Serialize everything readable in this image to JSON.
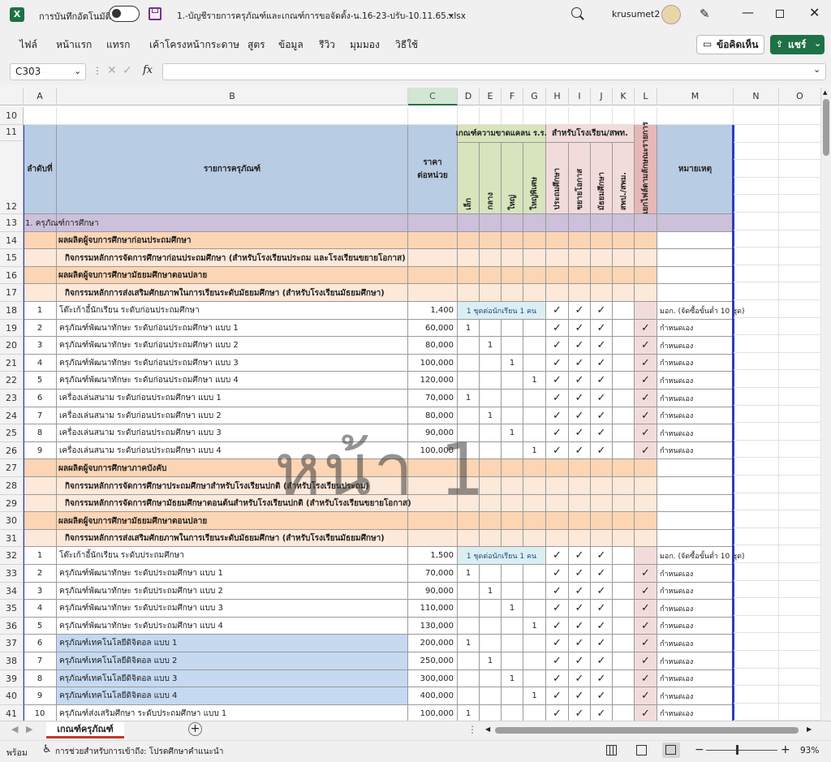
{
  "titlebar": {
    "autosave_label": "การบันทึกอัตโนมัติ",
    "filename": "1.-บัญชีรายการครุภัณฑ์และเกณฑ์การขอจัดตั้ง-น.16-23-ปรับ-10.11.65.xlsx",
    "user": "krusumet2"
  },
  "ribbon": {
    "tabs": [
      "ไฟล์",
      "หน้าแรก",
      "แทรก",
      "เค้าโครงหน้ากระดาษ",
      "สูตร",
      "ข้อมูล",
      "รีวิว",
      "มุมมอง",
      "วิธีใช้"
    ],
    "comments_label": "ข้อคิดเห็น",
    "share_label": "แชร์"
  },
  "formula_bar": {
    "name_box": "C303",
    "fx": "fx",
    "content": ""
  },
  "columns": [
    "A",
    "B",
    "C",
    "D",
    "E",
    "F",
    "G",
    "H",
    "I",
    "J",
    "K",
    "L",
    "M",
    "N",
    "O"
  ],
  "selected_column": "C",
  "header": {
    "col_a": "ลำดับที่",
    "col_b": "รายการครุภัณฑ์",
    "col_c_line1": "ราคา",
    "col_c_line2": "ต่อหน่วย",
    "group_size": "เกณฑ์ความขาดแคลน ร.ร.",
    "group_school": "สำหรับโรงเรียน/สพท.",
    "size_small": "เล็ก",
    "size_medium": "กลาง",
    "size_large": "ใหญ่",
    "size_xlarge": "ใหญ่พิเศษ",
    "school_primary": "ประถมศึกษา",
    "school_extended": "ขยายโอกาส",
    "school_secondary": "มัธยมศึกษา",
    "school_office": "สพป./สพม.",
    "col_l": "แยกไฟล์ตามลักษณะรายการ",
    "col_m": "หมายเหตุ"
  },
  "rows": [
    {
      "r": "13",
      "type": "cat",
      "b": "1. ครุภัณฑ์การศึกษา"
    },
    {
      "r": "14",
      "type": "sec",
      "b": "ผลผลิตผู้จบการศึกษาก่อนประถมศึกษา"
    },
    {
      "r": "15",
      "type": "sub",
      "b": "กิจกรรมหลักการจัดการศึกษาก่อนประถมศึกษา  (สำหรับโรงเรียนประถม และโรงเรียนขยายโอกาส)"
    },
    {
      "r": "16",
      "type": "sec",
      "b": "ผลผลิตผู้จบการศึกษามัธยมศึกษาตอนปลาย"
    },
    {
      "r": "17",
      "type": "sub",
      "b": "กิจกรรมหลักการส่งเสริมศักยภาพในการเรียนระดับมัธยมศึกษา (สำหรับโรงเรียนมัธยมศึกษา)"
    },
    {
      "r": "18",
      "type": "item",
      "a": "1",
      "b": "โต๊ะเก้าอี้นักเรียน ระดับก่อนประถมศึกษา",
      "c": "1,400",
      "d": "1  ชุดต่อนักเรียน  1  คน",
      "h": "✓",
      "i": "✓",
      "j": "✓",
      "l": "",
      "m": "มอก. (จัดซื้อขั้นต่ำ 10 ชุด)"
    },
    {
      "r": "19",
      "type": "item",
      "a": "2",
      "b": "ครุภัณฑ์พัฒนาทักษะ ระดับก่อนประถมศึกษา  แบบ  1",
      "c": "60,000",
      "d": "1",
      "h": "✓",
      "i": "✓",
      "j": "✓",
      "l": "✓",
      "m": "กำหนดเอง"
    },
    {
      "r": "20",
      "type": "item",
      "a": "3",
      "b": "ครุภัณฑ์พัฒนาทักษะ ระดับก่อนประถมศึกษา  แบบ  2",
      "c": "80,000",
      "e": "1",
      "h": "✓",
      "i": "✓",
      "j": "✓",
      "l": "✓",
      "m": "กำหนดเอง"
    },
    {
      "r": "21",
      "type": "item",
      "a": "4",
      "b": "ครุภัณฑ์พัฒนาทักษะ ระดับก่อนประถมศึกษา  แบบ  3",
      "c": "100,000",
      "f": "1",
      "h": "✓",
      "i": "✓",
      "j": "✓",
      "l": "✓",
      "m": "กำหนดเอง"
    },
    {
      "r": "22",
      "type": "item",
      "a": "5",
      "b": "ครุภัณฑ์พัฒนาทักษะ ระดับก่อนประถมศึกษา  แบบ  4",
      "c": "120,000",
      "g": "1",
      "h": "✓",
      "i": "✓",
      "j": "✓",
      "l": "✓",
      "m": "กำหนดเอง"
    },
    {
      "r": "23",
      "type": "item",
      "a": "6",
      "b": "เครื่องเล่นสนาม ระดับก่อนประถมศึกษา  แบบ 1",
      "c": "70,000",
      "d": "1",
      "h": "✓",
      "i": "✓",
      "j": "✓",
      "l": "✓",
      "m": "กำหนดเอง"
    },
    {
      "r": "24",
      "type": "item",
      "a": "7",
      "b": "เครื่องเล่นสนาม ระดับก่อนประถมศึกษา  แบบ 2",
      "c": "80,000",
      "e": "1",
      "h": "✓",
      "i": "✓",
      "j": "✓",
      "l": "✓",
      "m": "กำหนดเอง"
    },
    {
      "r": "25",
      "type": "item",
      "a": "8",
      "b": "เครื่องเล่นสนาม ระดับก่อนประถมศึกษา  แบบ 3",
      "c": "90,000",
      "f": "1",
      "h": "✓",
      "i": "✓",
      "j": "✓",
      "l": "✓",
      "m": "กำหนดเอง"
    },
    {
      "r": "26",
      "type": "item",
      "a": "9",
      "b": "เครื่องเล่นสนาม ระดับก่อนประถมศึกษา  แบบ 4",
      "c": "100,000",
      "g": "1",
      "h": "✓",
      "i": "✓",
      "j": "✓",
      "l": "✓",
      "m": "กำหนดเอง"
    },
    {
      "r": "27",
      "type": "sec",
      "b": "ผลผลิตผู้จบการศึกษาภาคบังคับ"
    },
    {
      "r": "28",
      "type": "sub",
      "b": "กิจกรรมหลักการจัดการศึกษาประถมศึกษาสำหรับโรงเรียนปกติ  (สำหรับโรงเรียนประถม)"
    },
    {
      "r": "29",
      "type": "sub",
      "b": "กิจกรรมหลักการจัดการศึกษามัธยมศึกษาตอนต้นสำหรับโรงเรียนปกติ (สำหรับโรงเรียนขยายโอกาส)"
    },
    {
      "r": "30",
      "type": "sec",
      "b": "ผลผลิตผู้จบการศึกษามัธยมศึกษาตอนปลาย"
    },
    {
      "r": "31",
      "type": "sub",
      "b": "กิจกรรมหลักการส่งเสริมศักยภาพในการเรียนระดับมัธยมศึกษา (สำหรับโรงเรียนมัธยมศึกษา)"
    },
    {
      "r": "32",
      "type": "item",
      "a": "1",
      "b": "โต๊ะเก้าอี้นักเรียน ระดับประถมศึกษา",
      "c": "1,500",
      "d": "1  ชุดต่อนักเรียน  1  คน",
      "h": "✓",
      "i": "✓",
      "j": "✓",
      "l": "",
      "m": "มอก. (จัดซื้อขั้นต่ำ 10 ชุด)"
    },
    {
      "r": "33",
      "type": "item",
      "a": "2",
      "b": "ครุภัณฑ์พัฒนาทักษะ ระดับประถมศึกษา  แบบ  1",
      "c": "70,000",
      "d": "1",
      "h": "✓",
      "i": "✓",
      "j": "✓",
      "l": "✓",
      "m": "กำหนดเอง"
    },
    {
      "r": "34",
      "type": "item",
      "a": "3",
      "b": "ครุภัณฑ์พัฒนาทักษะ ระดับประถมศึกษา  แบบ  2",
      "c": "90,000",
      "e": "1",
      "h": "✓",
      "i": "✓",
      "j": "✓",
      "l": "✓",
      "m": "กำหนดเอง"
    },
    {
      "r": "35",
      "type": "item",
      "a": "4",
      "b": "ครุภัณฑ์พัฒนาทักษะ ระดับประถมศึกษา  แบบ  3",
      "c": "110,000",
      "f": "1",
      "h": "✓",
      "i": "✓",
      "j": "✓",
      "l": "✓",
      "m": "กำหนดเอง"
    },
    {
      "r": "36",
      "type": "item",
      "a": "5",
      "b": "ครุภัณฑ์พัฒนาทักษะ ระดับประถมศึกษา  แบบ  4",
      "c": "130,000",
      "g": "1",
      "h": "✓",
      "i": "✓",
      "j": "✓",
      "l": "✓",
      "m": "กำหนดเอง"
    },
    {
      "r": "37",
      "type": "item",
      "blue": true,
      "a": "6",
      "b": "ครุภัณฑ์เทคโนโลยีดิจิตอล  แบบ 1",
      "c": "200,000",
      "d": "1",
      "h": "✓",
      "i": "✓",
      "j": "✓",
      "l": "✓",
      "m": "กำหนดเอง"
    },
    {
      "r": "38",
      "type": "item",
      "blue": true,
      "a": "7",
      "b": "ครุภัณฑ์เทคโนโลยีดิจิตอล  แบบ 2",
      "c": "250,000",
      "e": "1",
      "h": "✓",
      "i": "✓",
      "j": "✓",
      "l": "✓",
      "m": "กำหนดเอง"
    },
    {
      "r": "39",
      "type": "item",
      "blue": true,
      "a": "8",
      "b": "ครุภัณฑ์เทคโนโลยีดิจิตอล  แบบ 3",
      "c": "300,000",
      "f": "1",
      "h": "✓",
      "i": "✓",
      "j": "✓",
      "l": "✓",
      "m": "กำหนดเอง"
    },
    {
      "r": "40",
      "type": "item",
      "blue": true,
      "a": "9",
      "b": "ครุภัณฑ์เทคโนโลยีดิจิตอล  แบบ 4",
      "c": "400,000",
      "g": "1",
      "h": "✓",
      "i": "✓",
      "j": "✓",
      "l": "✓",
      "m": "กำหนดเอง"
    },
    {
      "r": "41",
      "type": "item",
      "a": "10",
      "b": "ครุภัณฑ์ส่งเสริมศึกษา ระดับประถมศึกษา แบบ 1",
      "c": "100,000",
      "d": "1",
      "h": "✓",
      "i": "✓",
      "j": "✓",
      "l": "✓",
      "m": "กำหนดเอง"
    }
  ],
  "watermark": "หน้า 1",
  "sheet_tab": "เกณฑ์ครุภัณฑ์",
  "status": {
    "ready": "พร้อม",
    "accessibility": "การช่วยสำหรับการเข้าถึง: โปรดศึกษาคำแนะนำ",
    "zoom": "93%"
  },
  "colors": {
    "header_blue": "#b8cce4",
    "category_purple": "#ccc0da",
    "section_orange": "#fcd5b4",
    "sub_peach": "#fde9d9",
    "size_group_green": "#d8e4bc",
    "school_group_pink": "#f2dcdb",
    "col_l_red": "#e6b8b7",
    "note_cyan": "#daeef3",
    "digital_blue": "#c5d9f1",
    "excel_green": "#217346"
  }
}
